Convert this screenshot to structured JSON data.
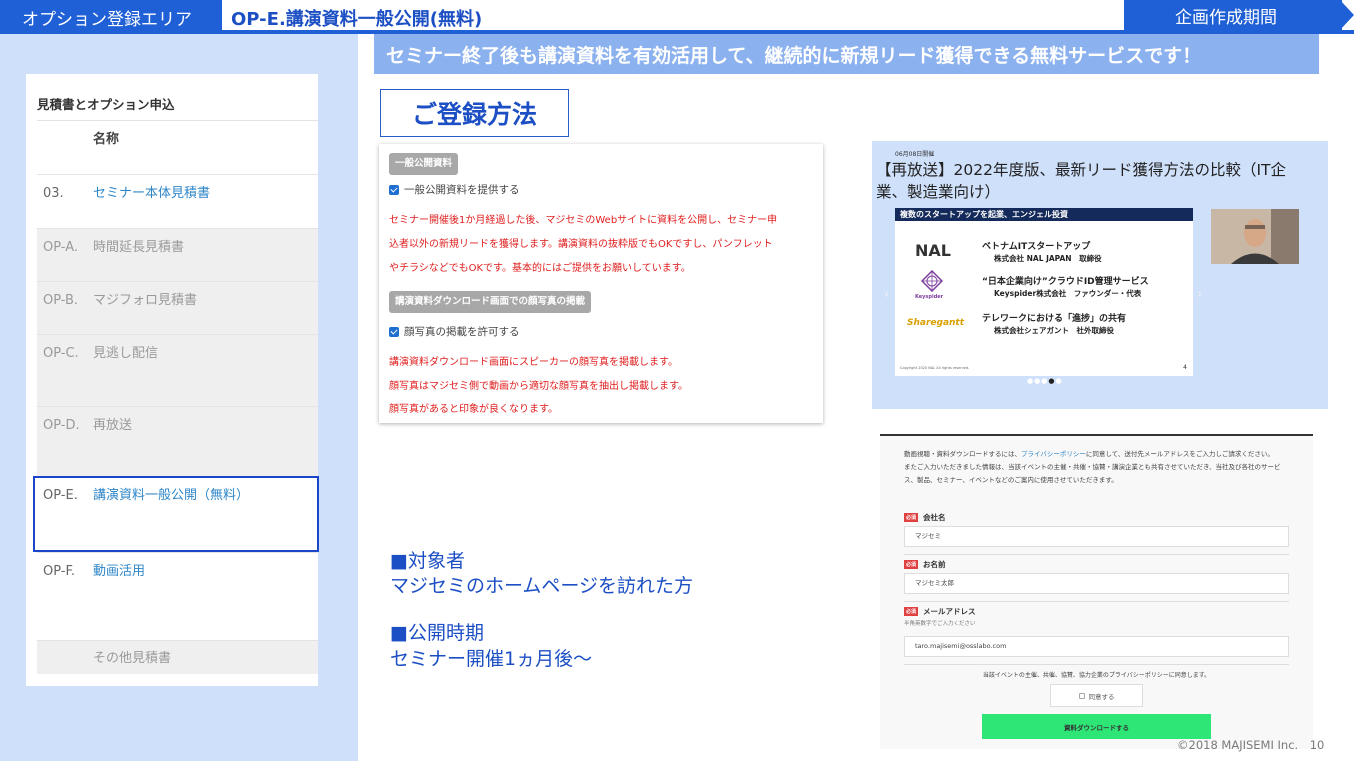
{
  "header": {
    "area_label": "オプション登録エリア",
    "title": "OP-E.講演資料一般公開(無料)",
    "period_label": "企画作成期間"
  },
  "tagline": "セミナー終了後も講演資料を有効活用して、継続的に新規リード獲得できる無料サービスです！",
  "method_title": "ご登録方法",
  "estimate": {
    "heading": "見積書とオプション申込",
    "column_name": "名称",
    "rows": [
      {
        "code": "03.",
        "name": "セミナー本体見積書"
      },
      {
        "code": "OP-A.",
        "name": "時間延長見積書"
      },
      {
        "code": "OP-B.",
        "name": "マジフォロ見積書"
      },
      {
        "code": "OP-C.",
        "name": "見逃し配信"
      },
      {
        "code": "OP-D.",
        "name": "再放送"
      },
      {
        "code": "OP-E.",
        "name": "講演資料一般公開（無料）"
      },
      {
        "code": "OP-F.",
        "name": "動画活用"
      },
      {
        "code": "",
        "name": "その他見積書"
      }
    ]
  },
  "form": {
    "section1_badge": "一般公開資料",
    "section1_checkbox": "一般公開資料を提供する",
    "section1_desc": [
      "セミナー開催後1か月経過した後、マジセミのWebサイトに資料を公開し、セミナー申",
      "込者以外の新規リードを獲得します。講演資料の抜粋版でもOKですし、パンフレット",
      "やチラシなどでもOKです。基本的にはご提供をお願いしています。"
    ],
    "section2_badge": "講演資料ダウンロード画面での顔写真の掲載",
    "section2_checkbox": "顔写真の掲載を許可する",
    "section2_desc": [
      "講演資料ダウンロード画面にスピーカーの顔写真を掲載します。",
      "顔写真はマジセミ側で動画から適切な顔写真を抽出し掲載します。",
      "顔写真があると印象が良くなります。"
    ]
  },
  "info": {
    "target_heading": "■対象者",
    "target_text": "マジセミのホームページを訪れた方",
    "period_heading": "■公開時期",
    "period_text": "セミナー開催1ヵ月後～"
  },
  "video": {
    "date": "06月08日開催",
    "title": "【再放送】2022年度版、最新リード獲得方法の比較（IT企業、製造業向け）",
    "slide_header": "複数のスタートアップを起業、エンジェル投資",
    "items": [
      {
        "logo": "NAL",
        "title": "ベトナムITスタートアップ",
        "sub": "株式会社 NAL JAPAN　取締役"
      },
      {
        "logo": "Keyspider",
        "title": "“日本企業向け”クラウドID管理サービス",
        "sub": "Keyspider株式会社　ファウンダー・代表"
      },
      {
        "logo": "Sharegantt",
        "title": "テレワークにおける「進捗」の共有",
        "sub": "株式会社シェアガント　社外取締役"
      }
    ],
    "copyright": "Copyright 2020 NAL All rights reserved.",
    "page_num": "4"
  },
  "download": {
    "intro_prefix": "動画視聴・資料ダウンロードするには、",
    "policy_link": "プライバシーポリシー",
    "intro_suffix": "に同意して、送付先メールアドレスをご入力しご請求ください。",
    "intro2": "またご入力いただきました情報は、当該イベントの主催・共催・協賛・講演企業とも共有させていただき、当社及び各社のサービス、製品、セミナー、イベントなどのご案内に使用させていただきます。",
    "required": "必須",
    "company_label": "会社名",
    "company_value": "マジセミ",
    "name_label": "お名前",
    "name_value": "マジセミ太郎",
    "email_label": "メールアドレス",
    "email_note": "半角英数字でご入力ください",
    "email_value": "taro.majisemi@osslabo.com",
    "agree_text": "当該イベントの主催、共催、協賛、協力企業のプライバシーポリシーに同意します。",
    "agree_checkbox": "同意する",
    "submit": "資料ダウンロードする"
  },
  "footer": "©2018 MAJISEMI Inc.　10"
}
